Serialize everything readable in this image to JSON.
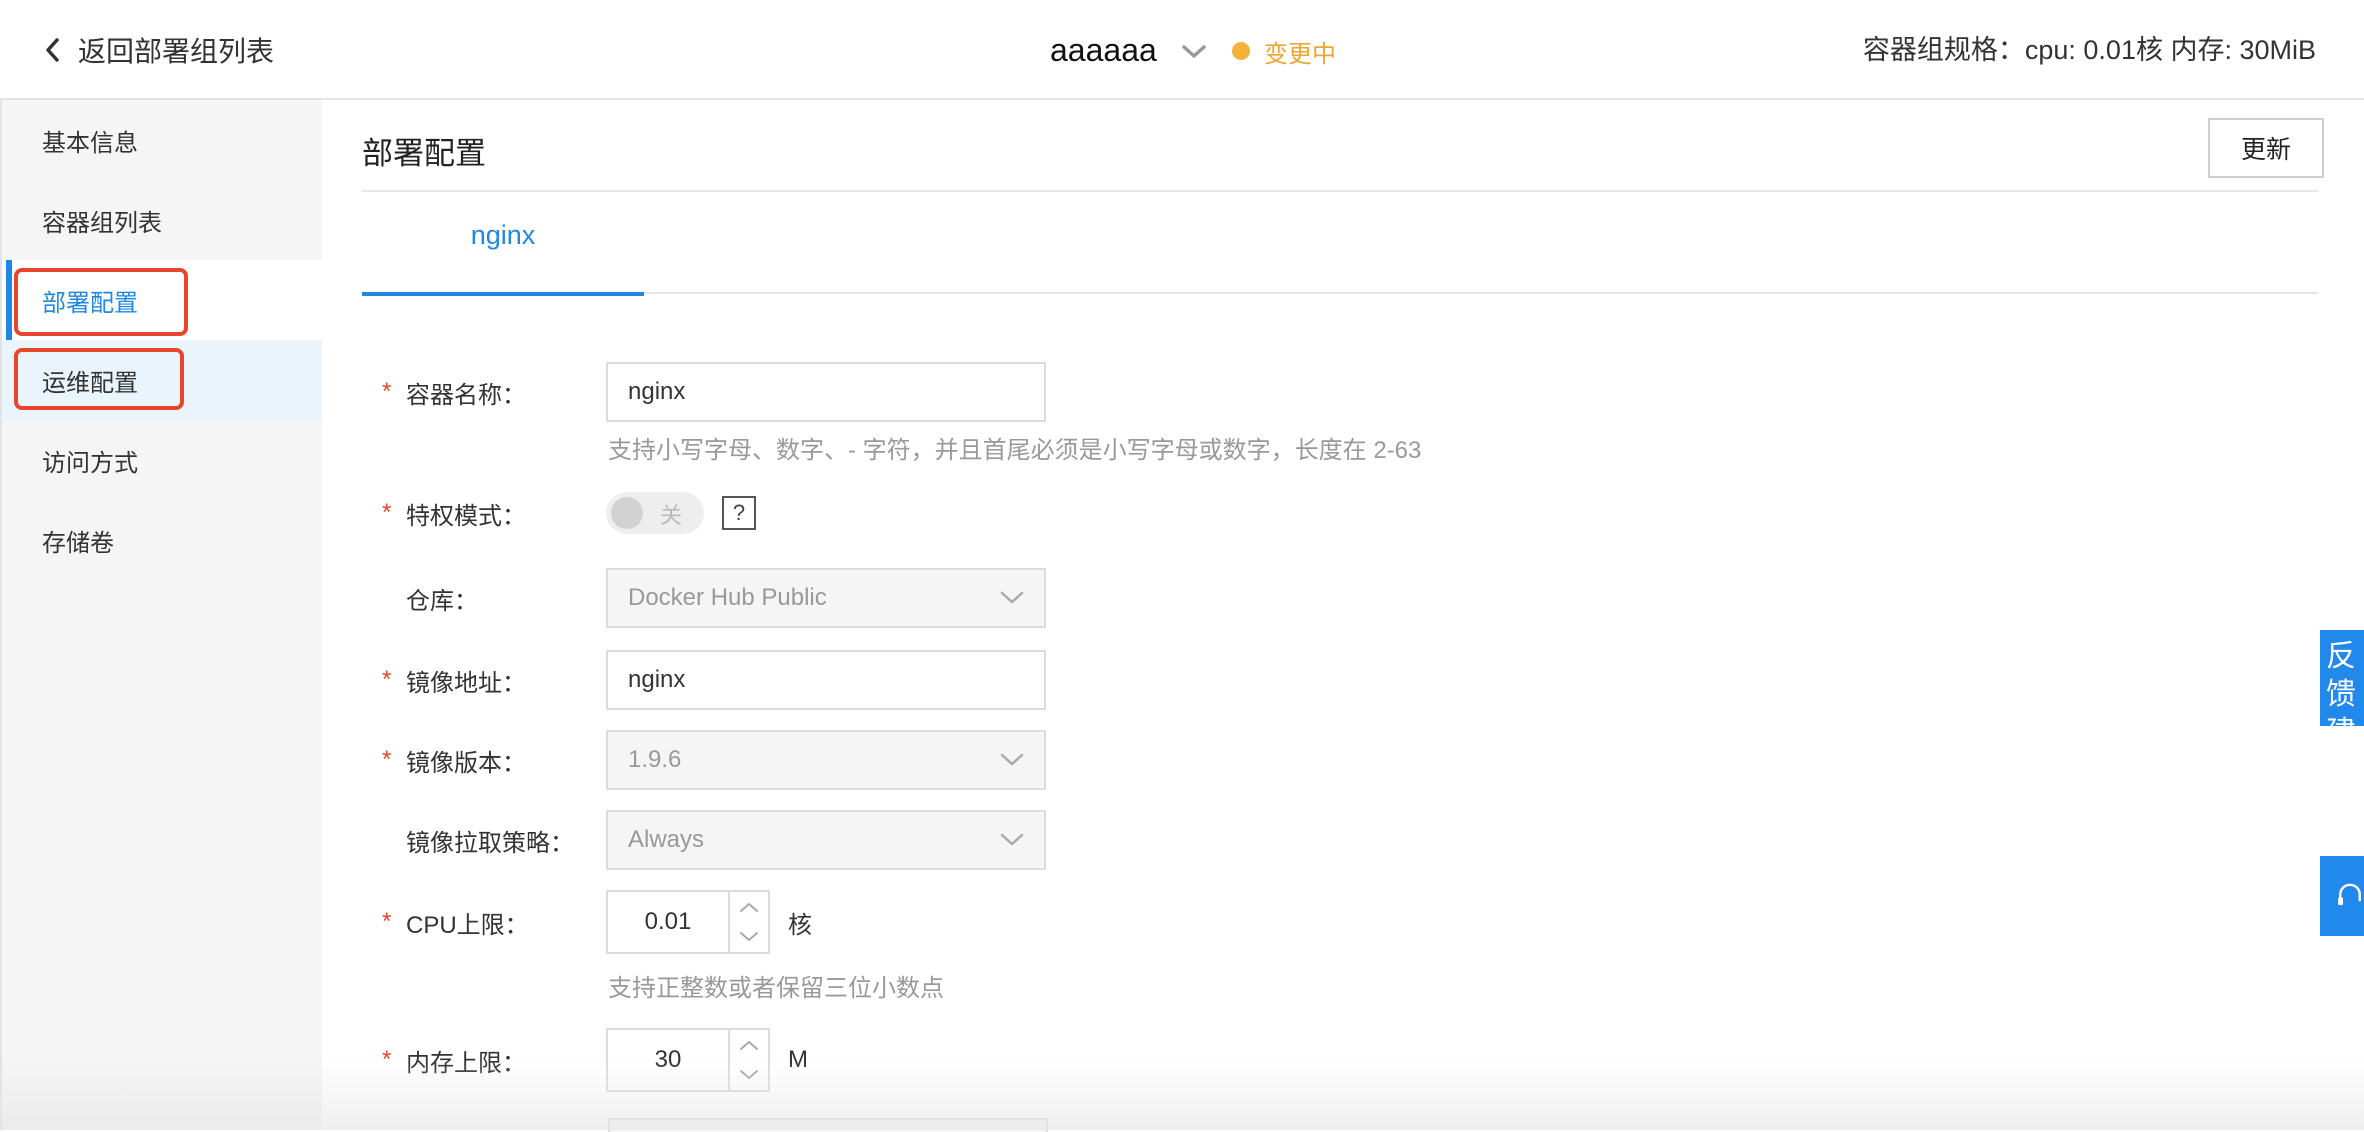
{
  "header": {
    "back_label": "返回部署组列表",
    "app_name": "aaaaaa",
    "status_text": "变更中",
    "spec_text": "容器组规格：cpu: 0.01核 内存: 30MiB",
    "status_color": "#f5b23a"
  },
  "sidebar": {
    "items": [
      {
        "label": "基本信息"
      },
      {
        "label": "容器组列表"
      },
      {
        "label": "部署配置"
      },
      {
        "label": "运维配置"
      },
      {
        "label": "访问方式"
      },
      {
        "label": "存储卷"
      }
    ],
    "active_index": 2,
    "accent_color": "#1e88e5",
    "highlight_color": "#e8452c"
  },
  "main": {
    "title": "部署配置",
    "update_label": "更新",
    "tabs": [
      {
        "label": "nginx"
      }
    ]
  },
  "form": {
    "container_name": {
      "label": "容器名称：",
      "value": "nginx",
      "hint": "支持小写字母、数字、- 字符，并且首尾必须是小写字母或数字，长度在 2-63"
    },
    "privileged": {
      "label": "特权模式：",
      "state_text": "关",
      "help_text": "?"
    },
    "repository": {
      "label": "仓库：",
      "value": "Docker Hub Public"
    },
    "image_address": {
      "label": "镜像地址：",
      "value": "nginx"
    },
    "image_version": {
      "label": "镜像版本：",
      "value": "1.9.6"
    },
    "pull_policy": {
      "label": "镜像拉取策略：",
      "value": "Always"
    },
    "cpu_limit": {
      "label": "CPU上限：",
      "value": "0.01",
      "unit": "核",
      "hint": "支持正整数或者保留三位小数点"
    },
    "memory_limit": {
      "label": "内存上限：",
      "value": "30",
      "unit": "M"
    },
    "required_mark": "*"
  },
  "floating": {
    "feedback_text": "反馈建议"
  },
  "icons": {
    "back": "chevron-left-icon",
    "app_switch": "chevron-down-icon",
    "select_arrow": "chevron-down-icon",
    "stepper_up": "chevron-up-icon",
    "stepper_down": "chevron-down-icon",
    "support": "headset-icon"
  }
}
